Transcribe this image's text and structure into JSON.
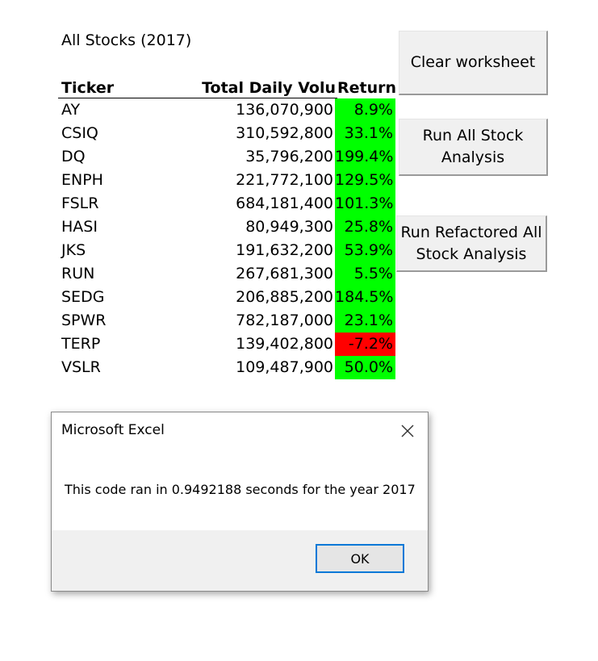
{
  "sheet": {
    "title": "All Stocks (2017)",
    "headers": {
      "ticker": "Ticker",
      "volume": "Total Daily Volu",
      "return": "Return"
    },
    "rows": [
      {
        "ticker": "AY",
        "volume": "136,070,900",
        "return": "8.9%",
        "status": "positive"
      },
      {
        "ticker": "CSIQ",
        "volume": "310,592,800",
        "return": "33.1%",
        "status": "positive"
      },
      {
        "ticker": "DQ",
        "volume": "35,796,200",
        "return": "199.4%",
        "status": "positive"
      },
      {
        "ticker": "ENPH",
        "volume": "221,772,100",
        "return": "129.5%",
        "status": "positive"
      },
      {
        "ticker": "FSLR",
        "volume": "684,181,400",
        "return": "101.3%",
        "status": "positive"
      },
      {
        "ticker": "HASI",
        "volume": "80,949,300",
        "return": "25.8%",
        "status": "positive"
      },
      {
        "ticker": "JKS",
        "volume": "191,632,200",
        "return": "53.9%",
        "status": "positive"
      },
      {
        "ticker": "RUN",
        "volume": "267,681,300",
        "return": "5.5%",
        "status": "positive"
      },
      {
        "ticker": "SEDG",
        "volume": "206,885,200",
        "return": "184.5%",
        "status": "positive"
      },
      {
        "ticker": "SPWR",
        "volume": "782,187,000",
        "return": "23.1%",
        "status": "positive"
      },
      {
        "ticker": "TERP",
        "volume": "139,402,800",
        "return": "-7.2%",
        "status": "negative"
      },
      {
        "ticker": "VSLR",
        "volume": "109,487,900",
        "return": "50.0%",
        "status": "positive"
      }
    ]
  },
  "buttons": {
    "clear": "Clear worksheet",
    "run_all": "Run All Stock Analysis",
    "run_refactored": "Run Refactored All Stock Analysis"
  },
  "dialog": {
    "title": "Microsoft Excel",
    "message": "This code ran in 0.9492188 seconds for the year 2017",
    "ok_label": "OK",
    "close_icon": "close-icon"
  },
  "colors": {
    "positive": "#00ff00",
    "negative": "#ff0000",
    "accent": "#0078d7"
  }
}
